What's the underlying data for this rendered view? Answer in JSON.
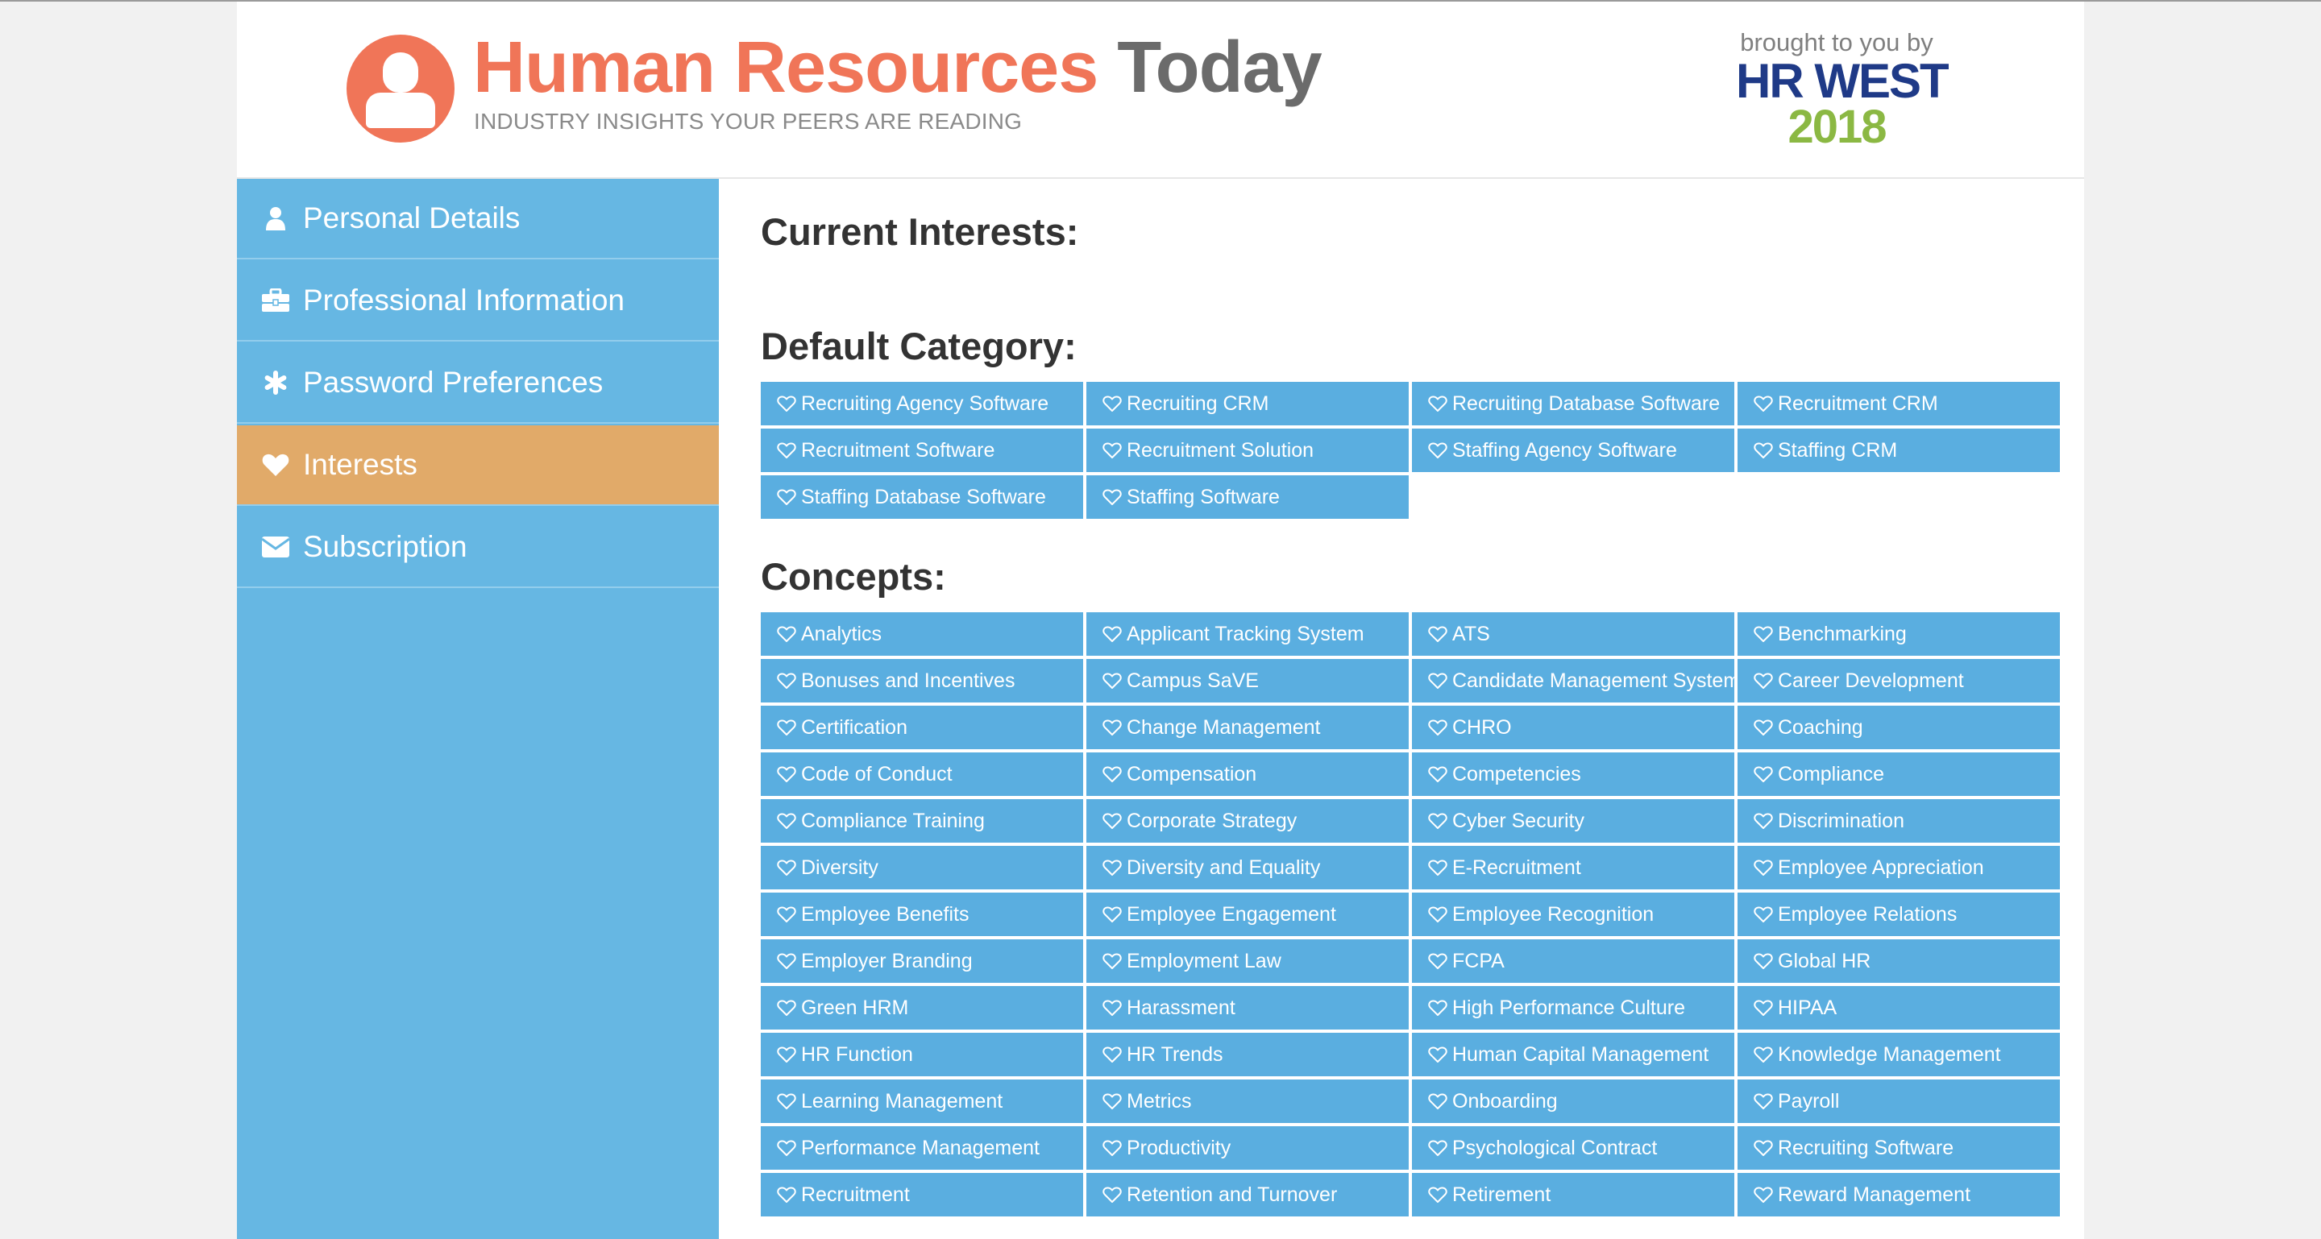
{
  "header": {
    "title_part1": "Human Resources",
    "title_part2": "Today",
    "tagline": "INDUSTRY INSIGHTS YOUR PEERS ARE READING",
    "sponsor_text": "brought to you by",
    "sponsor_name": "HR WEST",
    "sponsor_year": "2018"
  },
  "sidebar": {
    "items": [
      {
        "label": "Personal Details",
        "icon": "user-icon",
        "active": false
      },
      {
        "label": "Professional Information",
        "icon": "briefcase-icon",
        "active": false
      },
      {
        "label": "Password Preferences",
        "icon": "asterisk-icon",
        "active": false
      },
      {
        "label": "Interests",
        "icon": "heart-icon",
        "active": true
      },
      {
        "label": "Subscription",
        "icon": "envelope-icon",
        "active": false
      }
    ]
  },
  "main": {
    "current_interests_heading": "Current Interests:",
    "default_category_heading": "Default Category:",
    "concepts_heading": "Concepts:",
    "default_category": [
      "Recruiting Agency Software",
      "Recruiting CRM",
      "Recruiting Database Software",
      "Recruitment CRM",
      "Recruitment Software",
      "Recruitment Solution",
      "Staffing Agency Software",
      "Staffing CRM",
      "Staffing Database Software",
      "Staffing Software"
    ],
    "concepts": [
      "Analytics",
      "Applicant Tracking System",
      "ATS",
      "Benchmarking",
      "Bonuses and Incentives",
      "Campus SaVE",
      "Candidate Management System",
      "Career Development",
      "Certification",
      "Change Management",
      "CHRO",
      "Coaching",
      "Code of Conduct",
      "Compensation",
      "Competencies",
      "Compliance",
      "Compliance Training",
      "Corporate Strategy",
      "Cyber Security",
      "Discrimination",
      "Diversity",
      "Diversity and Equality",
      "E-Recruitment",
      "Employee Appreciation",
      "Employee Benefits",
      "Employee Engagement",
      "Employee Recognition",
      "Employee Relations",
      "Employer Branding",
      "Employment Law",
      "FCPA",
      "Global HR",
      "Green HRM",
      "Harassment",
      "High Performance Culture",
      "HIPAA",
      "HR Function",
      "HR Trends",
      "Human Capital Management",
      "Knowledge Management",
      "Learning Management",
      "Metrics",
      "Onboarding",
      "Payroll",
      "Performance Management",
      "Productivity",
      "Psychological Contract",
      "Recruiting Software",
      "Recruitment",
      "Retention and Turnover",
      "Retirement",
      "Reward Management"
    ]
  },
  "colors": {
    "brand_orange": "#f07558",
    "sidebar_blue": "#66b7e3",
    "active_orange": "#e1aa69",
    "tag_blue": "#5aaee0",
    "sponsor_navy": "#1f3a87",
    "sponsor_green": "#8bb843"
  }
}
